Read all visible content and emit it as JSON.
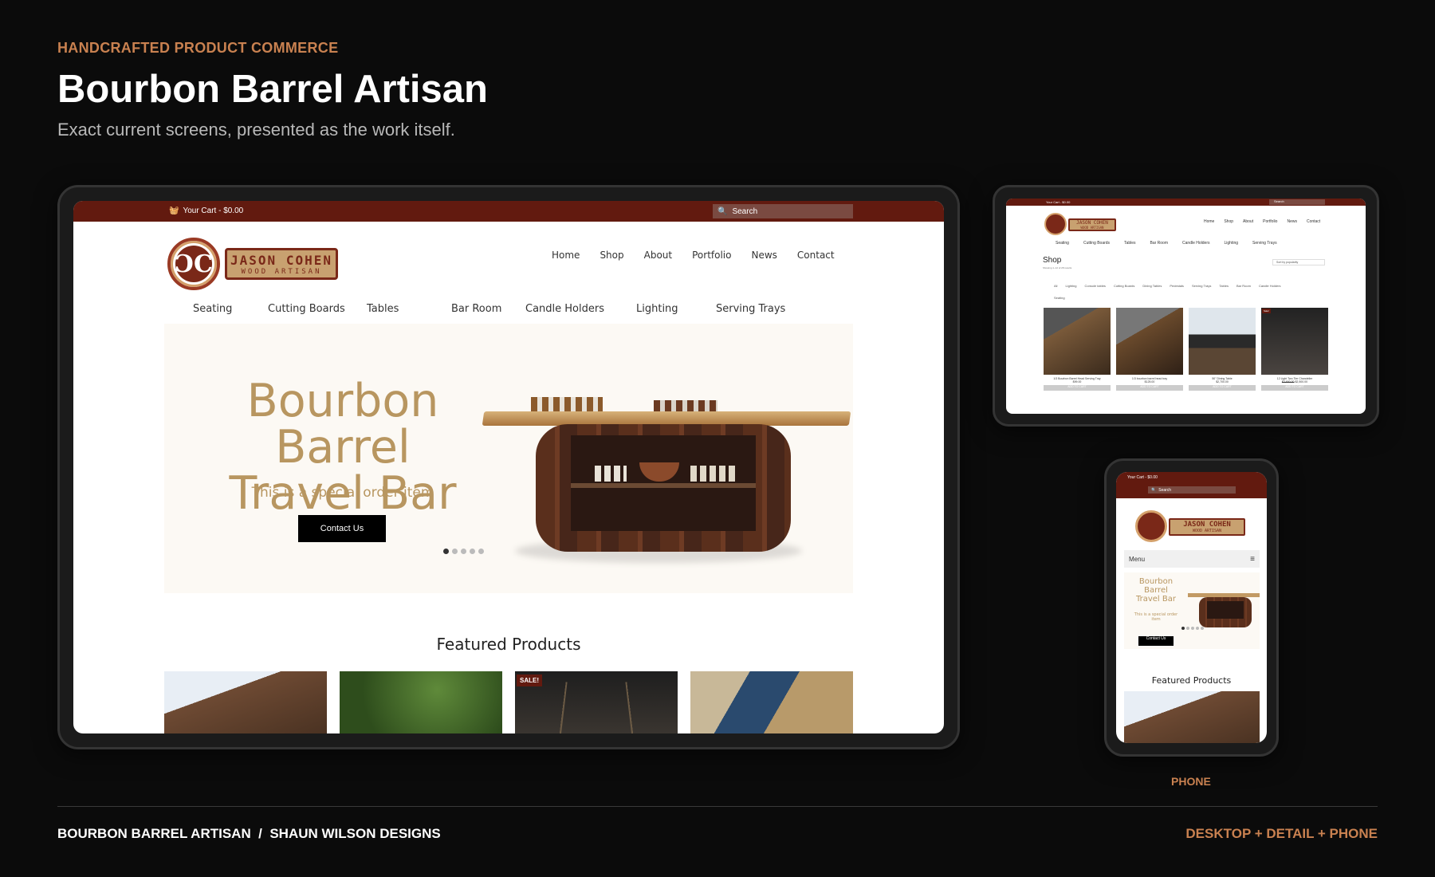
{
  "header": {
    "eyebrow": "HANDCRAFTED PRODUCT COMMERCE",
    "title": "Bourbon Barrel Artisan",
    "subtitle": "Exact current screens, presented as the work itself."
  },
  "brand": {
    "accent": "#c98150",
    "topbar": "#621a0f",
    "gold": "#b89660",
    "logo_line1": "JASON COHEN",
    "logo_line2": "WOOD ARTISAN"
  },
  "desktop": {
    "cart": "Your Cart - $0.00",
    "search": "Search",
    "nav": [
      "Home",
      "Shop",
      "About",
      "Portfolio",
      "News",
      "Contact"
    ],
    "categories": [
      "Seating",
      "Cutting Boards",
      "Tables",
      "Bar Room",
      "Candle Holders",
      "Lighting",
      "Serving Trays"
    ],
    "hero": {
      "line1": "Bourbon Barrel",
      "line2": "Travel Bar",
      "sub": "This is a special order item",
      "button": "Contact Us"
    },
    "featured": "Featured Products",
    "sale": "SALE!"
  },
  "tablet": {
    "cart": "Your Cart - $0.00",
    "search": "Search",
    "nav": [
      "Home",
      "Shop",
      "About",
      "Portfolio",
      "News",
      "Contact"
    ],
    "categories": [
      "Seating",
      "Cutting Boards",
      "Tables",
      "Bar Room",
      "Candle Holders",
      "Lighting",
      "Serving Trays"
    ],
    "shop_title": "Shop",
    "showing": "Showing 1–12 of 28 results",
    "sort": "Sort by popularity",
    "filters": [
      "All",
      "Lighting",
      "Console tables",
      "Cutting Boards",
      "Dining Tables",
      "Pedestals",
      "Serving Trays",
      "Tables",
      "Bar Room",
      "Candle Holders",
      "Seating"
    ],
    "products": [
      {
        "name": "1/3 Bourbon Barrel Head Serving Tray",
        "price": "$99.00",
        "old": ""
      },
      {
        "name": "1/3 bourbon barrel head tray",
        "price": "$125.00",
        "old": ""
      },
      {
        "name": "50\" Dining Table",
        "price": "$2,700.00",
        "old": ""
      },
      {
        "name": "12 Light Two Tier Chandelier",
        "price": "$2,500.00",
        "old": "$2,900.00"
      }
    ],
    "add": "ADD TO CART",
    "sale": "Sale!"
  },
  "phone": {
    "cart": "Your Cart - $0.00",
    "search": "Search",
    "menu": "Menu",
    "hero": {
      "line1": "Bourbon",
      "line2": "Barrel",
      "line3": "Travel Bar",
      "sub1": "This is a special order",
      "sub2": "item",
      "button": "Contact Us"
    },
    "featured": "Featured Products",
    "label": "PHONE"
  },
  "footer": {
    "left": "BOURBON BARREL ARTISAN  /  SHAUN WILSON DESIGNS",
    "right": "DESKTOP + DETAIL + PHONE"
  }
}
